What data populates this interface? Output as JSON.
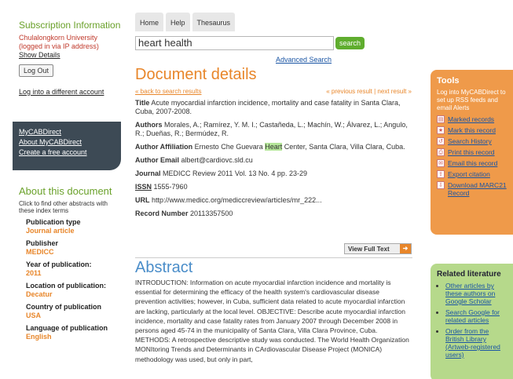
{
  "subscription": {
    "title": "Subscription Information",
    "org": "Chulalongkorn University",
    "login_note": "(logged in via IP address)",
    "show_details": "Show Details",
    "logout": "Log Out",
    "login_different": "Log into a different account"
  },
  "account_links": [
    "MyCABDirect",
    "About MyCABDirect",
    "Create a free account"
  ],
  "about": {
    "title": "About this document",
    "intro": "Click to find other abstracts with these index terms",
    "fields": [
      {
        "k": "Publication type",
        "v": "Journal article"
      },
      {
        "k": "Publisher",
        "v": "MEDICC"
      },
      {
        "k": "Year of publication:",
        "v": "2011"
      },
      {
        "k": "Location of publication:",
        "v": "Decatur"
      },
      {
        "k": "Country of publication",
        "v": "USA"
      },
      {
        "k": "Language of publication",
        "v": "English"
      }
    ]
  },
  "tabs": [
    "Home",
    "Help",
    "Thesaurus"
  ],
  "search": {
    "value": "heart health",
    "button": "search",
    "advanced": "Advanced Search"
  },
  "doc": {
    "heading": "Document details",
    "back": "« back to search results",
    "prevnext": "« previous result | next result »"
  },
  "record": {
    "title_k": "Title",
    "title_v": "Acute myocardial infarction incidence, mortality and case fatality in Santa Clara, Cuba, 2007-2008.",
    "authors_k": "Authors",
    "authors_v": "Morales, A.; Ramírez, Y. M. I.; Castañeda, L.; Machín, W.; Álvarez, L.; Angulo, R.; Dueñas, R.; Bermúdez, R.",
    "aff_k": "Author Affiliation",
    "aff_pre": "Ernesto Che Guevara ",
    "aff_hl": "Heart",
    "aff_post": " Center, Santa Clara, Villa Clara, Cuba.",
    "email_k": "Author Email",
    "email_v": "albert@cardiovc.sld.cu",
    "journal_k": "Journal",
    "journal_v": "MEDICC Review 2011 Vol. 13 No. 4 pp. 23-29",
    "issn_k": "ISSN",
    "issn_v": "1555-7960",
    "url_k": "URL",
    "url_v": "http://www.medicc.org/mediccreview/articles/mr_222...",
    "recnum_k": "Record Number",
    "recnum_v": "20113357500"
  },
  "view_full_text": "View Full Text",
  "abstract": {
    "heading": "Abstract",
    "text": "INTRODUCTION: Information on acute myocardial infarction incidence and mortality is essential for determining the efficacy of the health system's cardiovascular disease prevention activities; however, in Cuba, sufficient data related to acute myocardial infarction are lacking, particularly at the local level. OBJECTIVE: Describe acute myocardial infarction incidence, mortality and case fatality rates from January 2007 through December 2008 in persons aged 45-74 in the municipality of Santa Clara, Villa Clara Province, Cuba. METHODS: A retrospective descriptive study was conducted. The World Health Organization MONItoring Trends and Determinants in CArdiovascular Disease Project (MONICA) methodology was used, but only in part,"
  },
  "tools": {
    "title": "Tools",
    "intro": "Log into MyCABDirect to set up RSS feeds and email Alerts",
    "items": [
      {
        "label": "Marked records",
        "icon": "marked-icon"
      },
      {
        "label": "Mark this record",
        "icon": "star-icon"
      },
      {
        "label": "Search History",
        "icon": "history-icon"
      },
      {
        "label": "Print this record",
        "icon": "print-icon"
      },
      {
        "label": "Email this record",
        "icon": "email-icon"
      },
      {
        "label": "Export citation",
        "icon": "export-icon"
      },
      {
        "label": "Download MARC21 Record",
        "icon": "download-icon"
      }
    ]
  },
  "related": {
    "title": "Related literature",
    "items": [
      "Other articles by these authors on Google Scholar",
      "Search Google for related articles",
      "Order from the British Library (Artweb-registered users)"
    ]
  }
}
